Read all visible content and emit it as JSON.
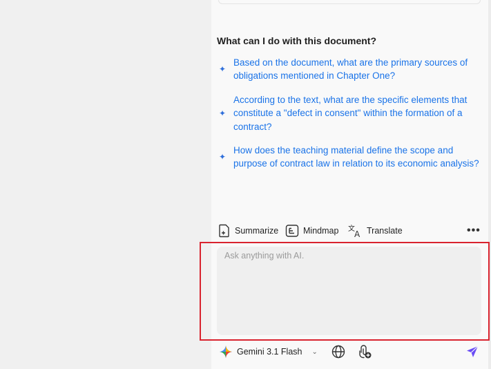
{
  "suggestions_section": {
    "title": "What can I do with this document?",
    "items": [
      {
        "icon": "sparkle-icon",
        "text": "Based on the document, what are the primary sources of obligations mentioned in Chapter One?"
      },
      {
        "icon": "sparkle-icon",
        "text": "According to the text, what are the specific elements that constitute a \"defect in consent\" within the formation of a contract?"
      },
      {
        "icon": "sparkle-icon",
        "text": "How does the teaching material define the scope and purpose of contract law in relation to its economic analysis?"
      }
    ]
  },
  "toolbar": {
    "summarize_label": "Summarize",
    "mindmap_label": "Mindmap",
    "translate_label": "Translate",
    "more_label": "•••"
  },
  "chat_input": {
    "placeholder": "Ask anything with AI.",
    "value": ""
  },
  "bottom_bar": {
    "model_name": "Gemini 3.1 Flash",
    "model_icon": "gemini-sparkle-icon",
    "web_icon": "globe-icon",
    "attach_icon": "attach-add-icon",
    "send_icon": "send-icon"
  },
  "colors": {
    "link": "#1a73e8",
    "highlight_border": "#d9232e",
    "send": "#6a4df5"
  }
}
